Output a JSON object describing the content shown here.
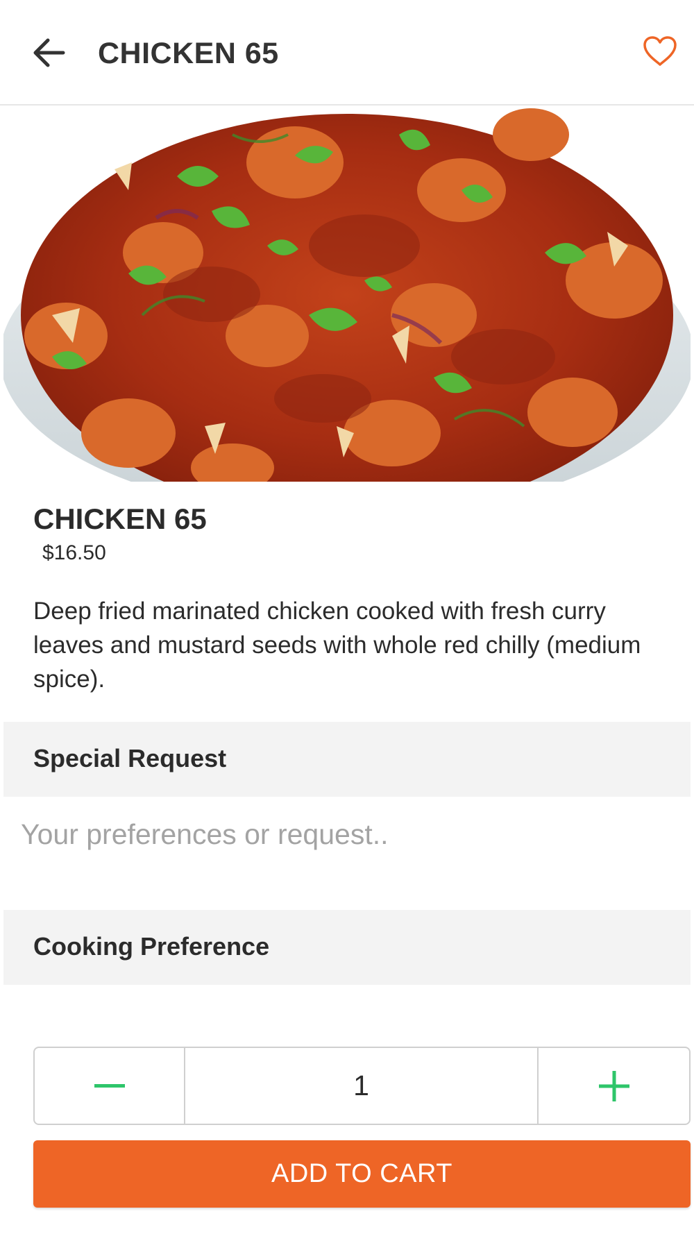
{
  "header": {
    "title": "CHICKEN 65",
    "back_icon": "arrow-left-icon",
    "favorite_icon": "heart-outline-icon"
  },
  "item": {
    "name": "CHICKEN 65",
    "price": "$16.50",
    "description": "Deep fried marinated chicken cooked with fresh curry leaves and mustard seeds with whole red chilly (medium spice)."
  },
  "special_request": {
    "heading": "Special Request",
    "placeholder": "Your preferences or request.."
  },
  "cooking_preference": {
    "heading": "Cooking Preference"
  },
  "quantity": {
    "value": "1",
    "minus_icon": "minus-icon",
    "plus_icon": "plus-icon"
  },
  "cart": {
    "label": "ADD TO CART"
  },
  "colors": {
    "accent": "#ee6526",
    "stepper_icon": "#2ec56a",
    "section_bg": "#f3f3f3",
    "text": "#2b2b2b"
  }
}
